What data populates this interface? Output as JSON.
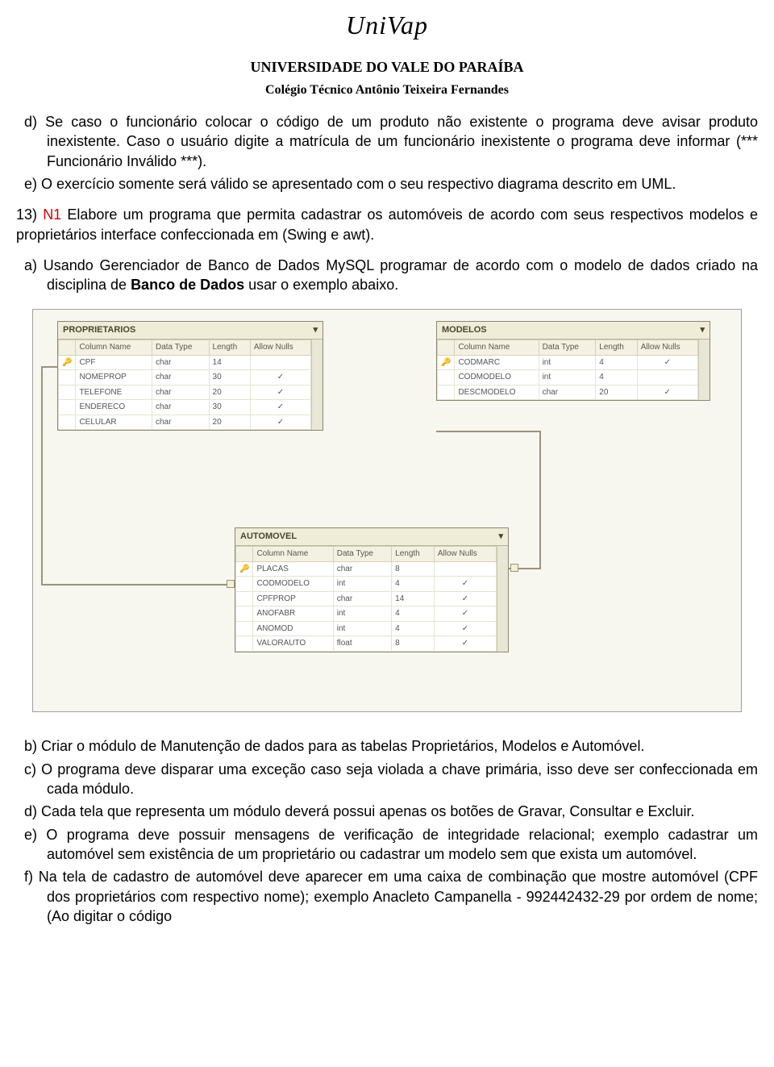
{
  "header": {
    "logo": "UniVap",
    "university": "UNIVERSIDADE DO VALE DO PARAÍBA",
    "school": "Colégio Técnico Antônio Teixeira Fernandes"
  },
  "text": {
    "item_d": "d)  Se caso o funcionário colocar o código de um produto não existente o programa deve avisar produto inexistente. Caso o usuário digite a matrícula de um funcionário inexistente o programa deve informar (*** Funcionário Inválido ***).",
    "item_e": "e)  O exercício somente será válido se apresentado com o seu respectivo diagrama descrito em UML.",
    "q13_prefix": "13) ",
    "q13_n1": "N1",
    "q13_rest": " Elabore um programa que permita cadastrar os automóveis de acordo com seus respectivos modelos e proprietários interface confeccionada em (Swing e awt).",
    "item_a_1": "a)  Usando Gerenciador de Banco de Dados MySQL programar de acordo com o modelo de dados criado na disciplina de ",
    "item_a_bold": "Banco de Dados",
    "item_a_2": " usar o exemplo abaixo.",
    "item_b": "b)  Criar o módulo de Manutenção de dados para as tabelas Proprietários, Modelos e Automóvel.",
    "item_c": "c)  O programa deve disparar uma exceção caso seja violada a chave primária, isso deve ser confeccionada em cada módulo.",
    "item_d2": "d)  Cada tela que representa um módulo deverá possui apenas os botões de Gravar, Consultar e Excluir.",
    "item_e2": "e)  O programa deve possuir mensagens de verificação de integridade relacional; exemplo cadastrar um automóvel sem existência de um proprietário ou cadastrar um modelo sem que exista um automóvel.",
    "item_f": "f)   Na tela de cadastro de automóvel deve aparecer em uma caixa de combinação que mostre automóvel (CPF dos proprietários com respectivo nome); exemplo Anacleto Campanella - 992442432-29 por ordem de nome; (Ao digitar o código"
  },
  "db": {
    "col_headers": [
      "Column Name",
      "Data Type",
      "Length",
      "Allow Nulls"
    ],
    "proprietarios": {
      "title": "PROPRIETARIOS",
      "rows": [
        {
          "k": "🔑",
          "name": "CPF",
          "type": "char",
          "len": "14",
          "null": ""
        },
        {
          "k": "",
          "name": "NOMEPROP",
          "type": "char",
          "len": "30",
          "null": "✓"
        },
        {
          "k": "",
          "name": "TELEFONE",
          "type": "char",
          "len": "20",
          "null": "✓"
        },
        {
          "k": "",
          "name": "ENDERECO",
          "type": "char",
          "len": "30",
          "null": "✓"
        },
        {
          "k": "",
          "name": "CELULAR",
          "type": "char",
          "len": "20",
          "null": "✓"
        }
      ]
    },
    "modelos": {
      "title": "MODELOS",
      "rows": [
        {
          "k": "🔑",
          "name": "CODMARC",
          "type": "int",
          "len": "4",
          "null": "✓"
        },
        {
          "k": "",
          "name": "CODMODELO",
          "type": "int",
          "len": "4",
          "null": ""
        },
        {
          "k": "",
          "name": "DESCMODELO",
          "type": "char",
          "len": "20",
          "null": "✓"
        }
      ]
    },
    "automovel": {
      "title": "AUTOMOVEL",
      "rows": [
        {
          "k": "🔑",
          "name": "PLACAS",
          "type": "char",
          "len": "8",
          "null": ""
        },
        {
          "k": "",
          "name": "CODMODELO",
          "type": "int",
          "len": "4",
          "null": "✓"
        },
        {
          "k": "",
          "name": "CPFPROP",
          "type": "char",
          "len": "14",
          "null": "✓"
        },
        {
          "k": "",
          "name": "ANOFABR",
          "type": "int",
          "len": "4",
          "null": "✓"
        },
        {
          "k": "",
          "name": "ANOMOD",
          "type": "int",
          "len": "4",
          "null": "✓"
        },
        {
          "k": "",
          "name": "VALORAUTO",
          "type": "float",
          "len": "8",
          "null": "✓"
        }
      ]
    }
  }
}
